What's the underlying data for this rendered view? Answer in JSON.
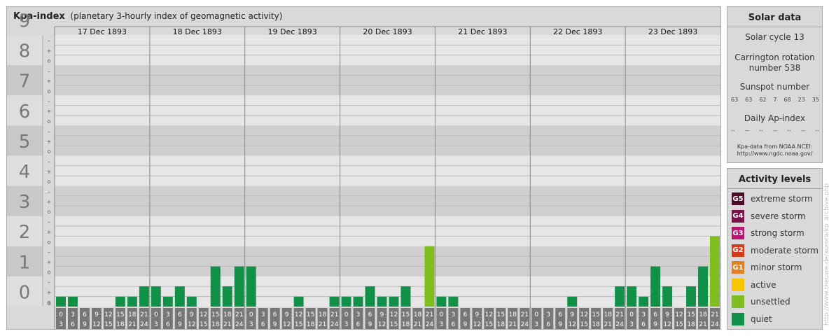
{
  "header": {
    "title": "Kpa-index",
    "subtitle": "(planetary 3-hourly index of geomagnetic activity)"
  },
  "chart_data": {
    "type": "bar",
    "title": "Kpa-index",
    "subtitle": "(planetary 3-hourly index of geomagnetic activity)",
    "ylim": [
      0,
      9
    ],
    "y_ticks": [
      "0",
      "1",
      "2",
      "3",
      "4",
      "5",
      "6",
      "7",
      "8",
      "9"
    ],
    "minor_tick_labels": [
      "o",
      "+",
      "–"
    ],
    "days": [
      "17 Dec 1893",
      "18 Dec 1893",
      "19 Dec 1893",
      "20 Dec 1893",
      "21 Dec 1893",
      "22 Dec 1893",
      "23 Dec 1893"
    ],
    "interval_start_labels": [
      "0",
      "3",
      "6",
      "9",
      "12",
      "15",
      "18",
      "21"
    ],
    "interval_end_labels": [
      "3",
      "6",
      "9",
      "12",
      "15",
      "18",
      "21",
      "24"
    ],
    "values": [
      [
        0.33,
        0.33,
        0,
        0,
        0,
        0.33,
        0.33,
        0.67
      ],
      [
        0.67,
        0.33,
        0.67,
        0.33,
        0,
        1.33,
        0.67,
        1.33
      ],
      [
        1.33,
        0,
        0,
        0,
        0.33,
        0,
        0,
        0.33
      ],
      [
        0.33,
        0.33,
        0.67,
        0.33,
        0.33,
        0.67,
        0,
        2
      ],
      [
        0.33,
        0.33,
        0,
        0,
        0,
        0,
        0,
        0
      ],
      [
        0,
        0,
        0,
        0.33,
        0,
        0,
        0,
        0.67
      ],
      [
        0.67,
        0.33,
        1.33,
        0.67,
        0,
        0.67,
        1.33,
        2.33
      ]
    ],
    "color_scale": {
      "quiet": "#119048",
      "unsettled": "#80bd20"
    },
    "grid": true
  },
  "solar": {
    "title": "Solar data",
    "cycle": "Solar cycle 13",
    "carrington": "Carrington rotation number 538",
    "sunspot_label": "Sunspot number",
    "sunspot_values": [
      "63",
      "63",
      "62",
      "7",
      "68",
      "23",
      "35"
    ],
    "ap_label": "Daily Ap-index",
    "ap_values": [
      "--",
      "--",
      "--",
      "--",
      "--",
      "--",
      "--"
    ],
    "credit_line1": "Kpa-data from NOAA NCEI:",
    "credit_line2": "http://www.ngdc.noaa.gov/"
  },
  "activity": {
    "title": "Activity levels",
    "levels": [
      {
        "code": "G5",
        "label": "extreme storm",
        "color": "#4d0a2b"
      },
      {
        "code": "G4",
        "label": "severe storm",
        "color": "#7a1047"
      },
      {
        "code": "G3",
        "label": "strong storm",
        "color": "#b5166f"
      },
      {
        "code": "G2",
        "label": "moderate storm",
        "color": "#d33a1c"
      },
      {
        "code": "G1",
        "label": "minor storm",
        "color": "#e5801f"
      },
      {
        "code": "",
        "label": "active",
        "color": "#f7c400"
      },
      {
        "code": "",
        "label": "unsettled",
        "color": "#80bd20"
      },
      {
        "code": "",
        "label": "quiet",
        "color": "#119048"
      }
    ]
  },
  "watermark": "http://www.theuwe.de/aurora/kp_archive.php"
}
